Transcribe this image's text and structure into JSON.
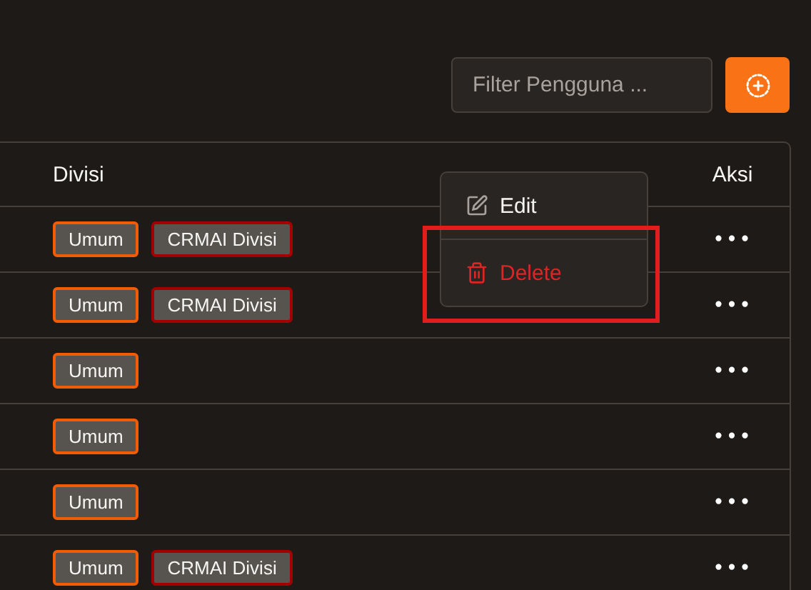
{
  "filter": {
    "placeholder": "Filter Pengguna ..."
  },
  "table": {
    "columns": [
      "Divisi",
      "Aksi"
    ],
    "rows": [
      {
        "tags": [
          {
            "label": "Umum",
            "color": "#f25c05"
          },
          {
            "label": "CRMAI Divisi",
            "color": "#a30000"
          }
        ],
        "action": "•••"
      },
      {
        "tags": [
          {
            "label": "Umum",
            "color": "#f25c05"
          },
          {
            "label": "CRMAI Divisi",
            "color": "#a30000"
          }
        ],
        "action": "•••"
      },
      {
        "tags": [
          {
            "label": "Umum",
            "color": "#f25c05"
          }
        ],
        "action": "•••"
      },
      {
        "tags": [
          {
            "label": "Umum",
            "color": "#f25c05"
          }
        ],
        "action": "•••"
      },
      {
        "tags": [
          {
            "label": "Umum",
            "color": "#f25c05"
          }
        ],
        "action": "•••"
      },
      {
        "tags": [
          {
            "label": "Umum",
            "color": "#f25c05"
          },
          {
            "label": "CRMAI Divisi",
            "color": "#a30000"
          }
        ],
        "action": "•••"
      }
    ]
  },
  "menu": {
    "items": [
      {
        "label": "Edit",
        "kind": "edit",
        "highlighted": false
      },
      {
        "label": "Delete",
        "kind": "delete",
        "highlighted": true
      }
    ]
  }
}
